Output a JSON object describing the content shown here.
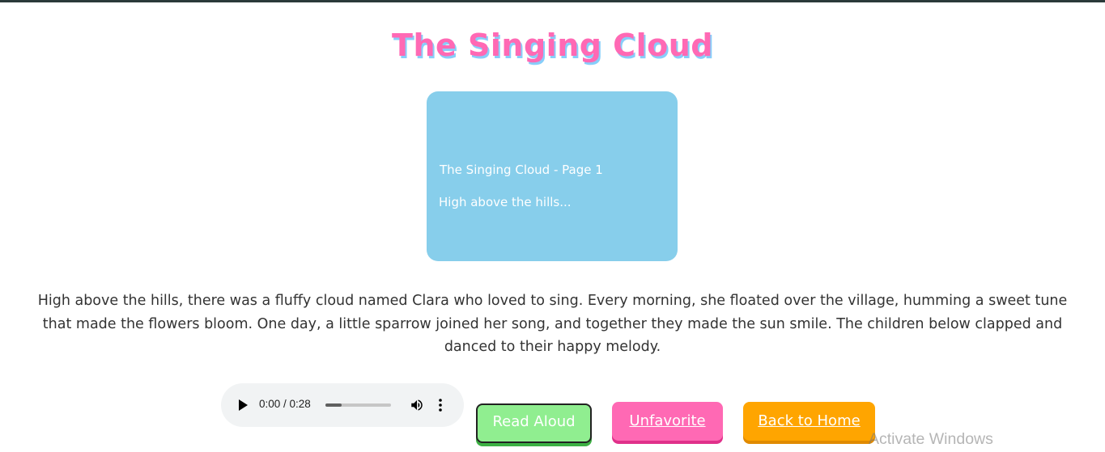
{
  "page": {
    "title": "The Singing Cloud"
  },
  "book_page": {
    "label": "The Singing Cloud - Page 1",
    "snippet": "High above the hills..."
  },
  "story": {
    "text": "High above the hills, there was a fluffy cloud named Clara who loved to sing. Every morning, she floated over the village, humming a sweet tune that made the flowers bloom. One day, a little sparrow joined her song, and together they made the sun smile. The children below clapped and danced to their happy melody."
  },
  "audio": {
    "time_display": "0:00 / 0:28",
    "progress_fraction": 0.25,
    "play_icon": "play-icon",
    "volume_icon": "volume-icon",
    "more_icon": "more-options-icon"
  },
  "buttons": {
    "read_aloud": "Read Aloud",
    "unfavorite": "Unfavorite",
    "back_home": "Back to Home"
  },
  "colors": {
    "title": "#ff69b4",
    "title_shadow": "#87cefa",
    "card": "#87ceeb",
    "read_aloud": "#90ee90",
    "unfavorite": "#ff69b4",
    "back_home": "#ffa500"
  },
  "system": {
    "watermark": "Activate Windows"
  }
}
